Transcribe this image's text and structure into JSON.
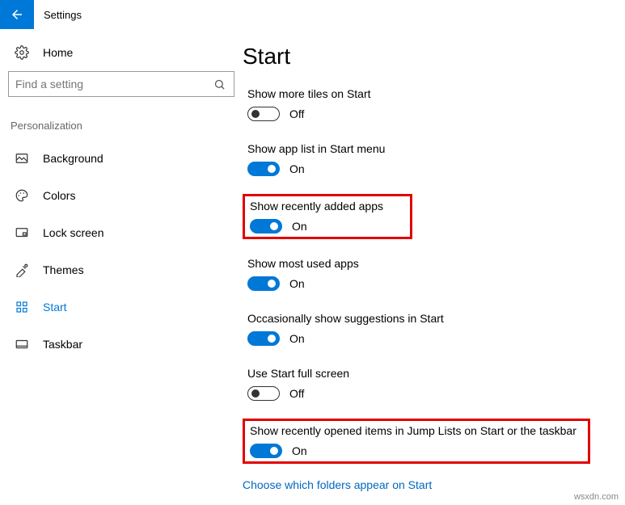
{
  "titlebar": {
    "title": "Settings"
  },
  "sidebar": {
    "home": "Home",
    "search_placeholder": "Find a setting",
    "category": "Personalization",
    "items": [
      {
        "label": "Background"
      },
      {
        "label": "Colors"
      },
      {
        "label": "Lock screen"
      },
      {
        "label": "Themes"
      },
      {
        "label": "Start"
      },
      {
        "label": "Taskbar"
      }
    ]
  },
  "main": {
    "heading": "Start",
    "settings": [
      {
        "label": "Show more tiles on Start",
        "state": "Off"
      },
      {
        "label": "Show app list in Start menu",
        "state": "On"
      },
      {
        "label": "Show recently added apps",
        "state": "On"
      },
      {
        "label": "Show most used apps",
        "state": "On"
      },
      {
        "label": "Occasionally show suggestions in Start",
        "state": "On"
      },
      {
        "label": "Use Start full screen",
        "state": "Off"
      },
      {
        "label": "Show recently opened items in Jump Lists on Start or the taskbar",
        "state": "On"
      }
    ],
    "link": "Choose which folders appear on Start"
  },
  "watermark": "wsxdn.com"
}
